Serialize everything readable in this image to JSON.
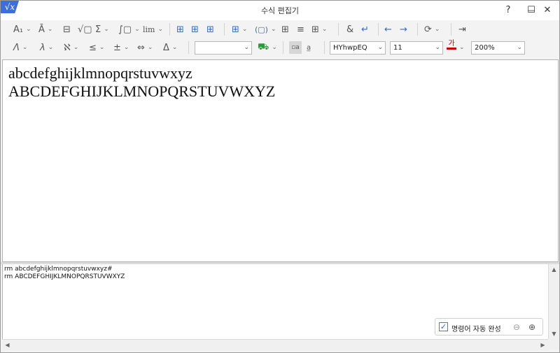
{
  "app": {
    "icon_text": "√x",
    "title": "수식 편집기"
  },
  "window_controls": {
    "help": "?",
    "minimize": "—",
    "maximize": "☐",
    "close": "✕"
  },
  "toolbar1": [
    {
      "name": "subscript-superscript-tool",
      "glyph": "A₁",
      "dropdown": true
    },
    {
      "name": "decoration-tool",
      "glyph": "Ā",
      "dropdown": true
    },
    {
      "name": "fraction-tool",
      "glyph": "⊟"
    },
    {
      "name": "root-tool",
      "glyph": "√▢"
    },
    {
      "name": "sum-tool",
      "glyph": "Σ",
      "dropdown": true
    },
    {
      "name": "integral-tool",
      "glyph": "∫▢",
      "dropdown": true
    },
    {
      "name": "limit-tool",
      "glyph": "lim",
      "dropdown": true
    },
    {
      "name": "matrix-ab-tool",
      "glyph": "⊞"
    },
    {
      "name": "matrix-ud-tool",
      "glyph": "⊞"
    },
    {
      "name": "matrix-stack-tool",
      "glyph": "⊞"
    },
    {
      "name": "align-tool",
      "glyph": "⊞",
      "dropdown": true
    },
    {
      "name": "parentheses-tool",
      "glyph": "(▢)",
      "dropdown": true
    },
    {
      "name": "grid-tool",
      "glyph": "⊞"
    },
    {
      "name": "line-tool",
      "glyph": "≡"
    },
    {
      "name": "table-tool",
      "glyph": "⊞",
      "dropdown": true
    },
    {
      "name": "ampersand-tool",
      "glyph": "&"
    },
    {
      "name": "newline-tool",
      "glyph": "↵"
    },
    {
      "name": "prev-arrow-tool",
      "glyph": "←"
    },
    {
      "name": "next-arrow-tool",
      "glyph": "→"
    },
    {
      "name": "insert-tool",
      "glyph": "⟳",
      "dropdown": true
    },
    {
      "name": "exit-tool",
      "glyph": "⇥"
    }
  ],
  "toolbar2": [
    {
      "name": "greek-lower-tool",
      "glyph": "Λ",
      "dropdown": true
    },
    {
      "name": "lambda-tool",
      "glyph": "λ",
      "dropdown": true
    },
    {
      "name": "aleph-tool",
      "glyph": "ℵ",
      "dropdown": true
    },
    {
      "name": "relation-tool",
      "glyph": "≤",
      "dropdown": true
    },
    {
      "name": "plus-minus-tool",
      "glyph": "±",
      "dropdown": true
    },
    {
      "name": "arrow-tool",
      "glyph": "⇔",
      "dropdown": true
    },
    {
      "name": "delta-tool",
      "glyph": "Δ",
      "dropdown": true
    }
  ],
  "format": {
    "style_value": "",
    "font_value": "HYhwpEQ",
    "size_value": "11",
    "color_glyph": "가",
    "color_bar": "#cc0000",
    "zoom_value": "200%"
  },
  "editor": {
    "lines": [
      "abcdefghijklmnopqrstuvwxyz",
      "ABCDEFGHIJKLMNOPQRSTUVWXYZ"
    ]
  },
  "script": {
    "lines": [
      "rm abcdefghijklmnopqrstuvwxyz#",
      "rm ABCDEFGHIJKLMNOPQRSTUVWXYZ"
    ]
  },
  "autocomplete": {
    "checked_glyph": "✓",
    "label": "명령어 자동 완성",
    "zoom_out": "⊖",
    "zoom_in": "⊕"
  },
  "scroll_arrows": {
    "up": "▲",
    "down": "▼",
    "left": "◀",
    "right": "▶"
  }
}
